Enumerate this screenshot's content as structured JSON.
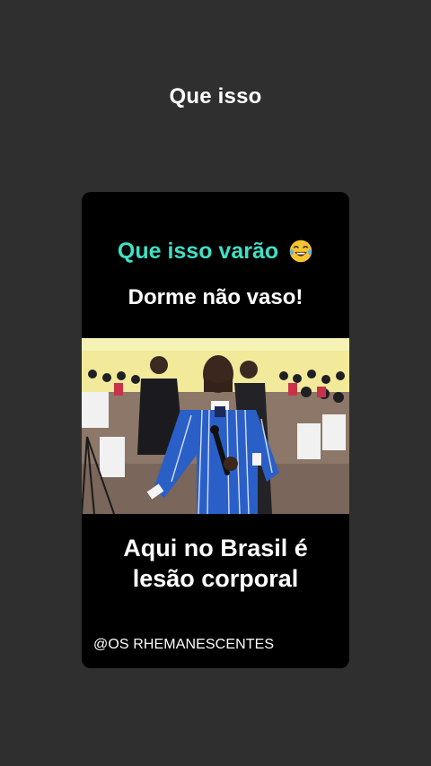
{
  "story": {
    "caption": "Que isso"
  },
  "card": {
    "headline": "Que isso varão",
    "headline_emoji": "tears-of-joy-emoji",
    "subheadline": "Dorme não vaso!",
    "bottom_line_1": "Aqui no Brasil é",
    "bottom_line_2": "lesão corporal",
    "handle": "@OS RHEMANESCENTES"
  },
  "colors": {
    "background": "#2f2f2f",
    "card": "#000000",
    "headline": "#3fe0c5",
    "text": "#ffffff"
  }
}
